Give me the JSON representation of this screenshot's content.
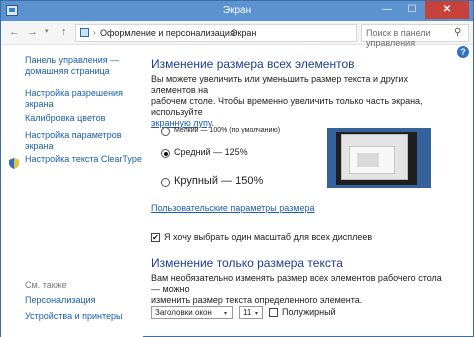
{
  "window": {
    "title": "Экран",
    "minimize": "—",
    "maximize": "☐",
    "close": "✕"
  },
  "addressbar": {
    "back": "←",
    "forward": "→",
    "history_dropdown": "▾",
    "up": "↑",
    "breadcrumb": [
      "Оформление и персонализация",
      "Экран"
    ],
    "separator": "›",
    "dropdown": "▾",
    "refresh": "↻",
    "search_placeholder": "Поиск в панели управления",
    "search_glyph": "⚲"
  },
  "help": "?",
  "sidebar": {
    "home": [
      "Панель управления —",
      "домашняя страница"
    ],
    "items": [
      [
        "Настройка разрешения",
        "экрана"
      ],
      [
        "Калибровка цветов"
      ],
      [
        "Настройка параметров",
        "экрана"
      ],
      [
        "Настройка текста ClearType"
      ]
    ],
    "see_also_title": "См. также",
    "see_also": [
      "Персонализация",
      "Устройства и принтеры"
    ]
  },
  "main": {
    "size_heading": "Изменение размера всех элементов",
    "size_desc_1": "Вы можете увеличить или уменьшить размер текста и других элементов на",
    "size_desc_2": "рабочем столе. Чтобы временно увеличить только часть экрана, используйте",
    "magnifier_link": "экранную лупу",
    "period": ".",
    "options": [
      {
        "label": "Мелкий — 100% (по умолчанию)",
        "checked": false
      },
      {
        "label": "Средний — 125%",
        "checked": true
      },
      {
        "label": "Крупный — 150%",
        "checked": false
      }
    ],
    "custom_size_link": "Пользовательские параметры размера",
    "one_scale_check": "✔",
    "one_scale_label": "Я хочу выбрать один масштаб для всех дисплеев",
    "text_heading": "Изменение только размера текста",
    "text_desc_1": "Вам необязательно изменять размер всех элементов рабочего стола — можно",
    "text_desc_2": "изменить размер текста определенного элемента.",
    "element_select": "Заголовки окон",
    "font_size_select": "11",
    "select_chevron": "▾",
    "bold_label": "Полужирный",
    "bold_checked": false
  },
  "colors": {
    "heading": "#1e3e8c",
    "link": "#1a5fa8",
    "titlebar": "#5b92cf",
    "close": "#c7423b"
  }
}
